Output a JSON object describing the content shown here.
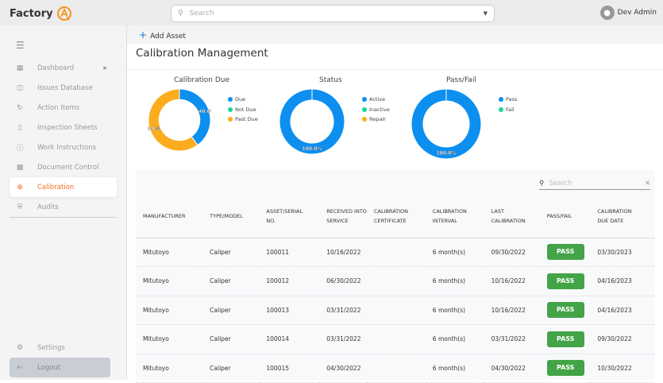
{
  "header": {
    "logo": "Factory",
    "search_placeholder": "Search",
    "user": "Dev Admin"
  },
  "sidebar": {
    "items": [
      {
        "label": "Dashboard",
        "icon": "grid-icon"
      },
      {
        "label": "Issues Database",
        "icon": "database-icon"
      },
      {
        "label": "Action Items",
        "icon": "refresh-icon"
      },
      {
        "label": "Inspection Sheets",
        "icon": "file-icon"
      },
      {
        "label": "Work Instructions",
        "icon": "help-icon"
      },
      {
        "label": "Document Control",
        "icon": "folder-icon"
      },
      {
        "label": "Calibration",
        "icon": "crosshair-icon",
        "active": true
      },
      {
        "label": "Audits",
        "icon": "shield-icon"
      }
    ],
    "settings": "Settings",
    "logout": "Logout"
  },
  "toolbar": {
    "add_asset": "Add Asset"
  },
  "page_title": "Calibration Management",
  "chart_data": [
    {
      "type": "pie",
      "title": "Calibration Due",
      "legend": [
        "Due",
        "Not Due",
        "Past Due"
      ],
      "values": [
        40,
        0,
        60
      ],
      "labels": [
        "40.0%",
        "",
        "60.0%"
      ],
      "colors": [
        "#0d8ff0",
        "#1ed68f",
        "#fbad1e"
      ]
    },
    {
      "type": "pie",
      "title": "Status",
      "legend": [
        "Active",
        "Inactive",
        "Repair"
      ],
      "values": [
        100,
        0,
        0
      ],
      "labels": [
        "100.0%",
        "",
        ""
      ],
      "colors": [
        "#0d8ff0",
        "#1ed68f",
        "#fbad1e"
      ]
    },
    {
      "type": "pie",
      "title": "Pass/Fail",
      "legend": [
        "Pass",
        "Fail"
      ],
      "values": [
        100,
        0
      ],
      "labels": [
        "100.0%",
        ""
      ],
      "colors": [
        "#0d8ff0",
        "#1ed68f"
      ]
    }
  ],
  "table": {
    "search_placeholder": "Search",
    "columns": [
      "MANUFACTURER",
      "TYPE/MODEL",
      "ASSET/SERIAL NO.",
      "RECEIVED INTO SERVICE",
      "CALIBRATION CERTIFICATE",
      "CALIBRATION INTERVAL",
      "LAST CALIBRATION",
      "PASS/FAIL",
      "CALIBRATION DUE DATE"
    ],
    "rows": [
      [
        "Mitutoyo",
        "Caliper",
        "100011",
        "10/16/2022",
        "",
        "6 month(s)",
        "09/30/2022",
        "PASS",
        "03/30/2023"
      ],
      [
        "Mitutoyo",
        "Caliper",
        "100012",
        "06/30/2022",
        "",
        "6 month(s)",
        "10/16/2022",
        "PASS",
        "04/16/2023"
      ],
      [
        "Mitutoyo",
        "Caliper",
        "100013",
        "03/31/2022",
        "",
        "6 month(s)",
        "10/16/2022",
        "PASS",
        "04/16/2023"
      ],
      [
        "Mitutoyo",
        "Caliper",
        "100014",
        "03/31/2022",
        "",
        "6 month(s)",
        "03/31/2022",
        "PASS",
        "09/30/2022"
      ],
      [
        "Mitutoyo",
        "Caliper",
        "100015",
        "04/30/2022",
        "",
        "6 month(s)",
        "04/30/2022",
        "PASS",
        "10/30/2022"
      ]
    ]
  }
}
